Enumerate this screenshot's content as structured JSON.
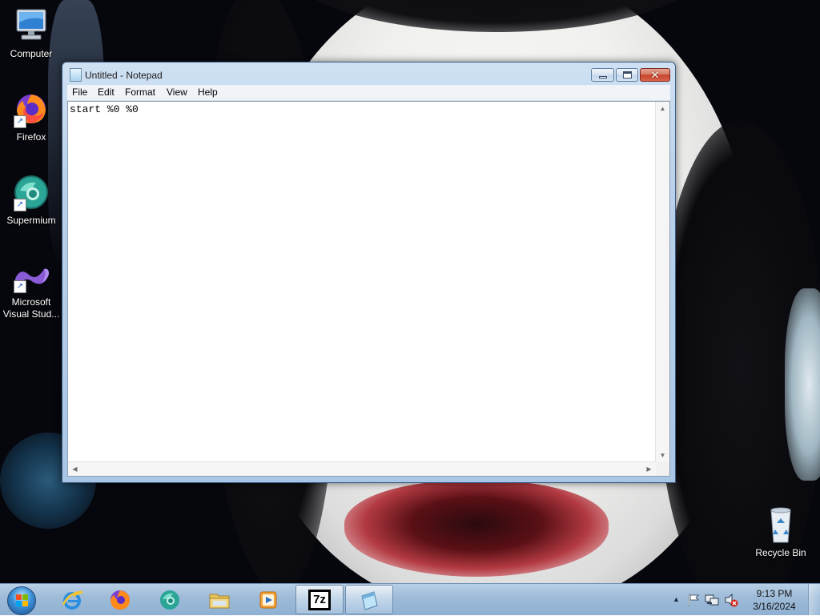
{
  "desktop": {
    "icons": [
      {
        "label": "Computer",
        "icon": "computer-icon"
      },
      {
        "label": "Firefox",
        "icon": "firefox-icon"
      },
      {
        "label": "Supermium",
        "icon": "supermium-icon"
      },
      {
        "label": "Microsoft Visual Stud...",
        "icon": "visual-studio-icon"
      },
      {
        "label": "Recycle Bin",
        "icon": "recycle-bin-icon"
      }
    ]
  },
  "notepad": {
    "title": "Untitled - Notepad",
    "menu": [
      "File",
      "Edit",
      "Format",
      "View",
      "Help"
    ],
    "content": "start %0 %0",
    "caption_buttons": {
      "minimize": "minimize-icon",
      "maximize": "maximize-icon",
      "close": "close-icon"
    },
    "close_symbol": "✕"
  },
  "taskbar": {
    "items": [
      {
        "name": "internet-explorer",
        "icon": "internet-explorer-icon"
      },
      {
        "name": "firefox",
        "icon": "firefox-icon"
      },
      {
        "name": "supermium",
        "icon": "supermium-icon"
      },
      {
        "name": "file-explorer",
        "icon": "folder-icon"
      },
      {
        "name": "media-player",
        "icon": "media-player-icon"
      },
      {
        "name": "7zip",
        "icon": "7zip-icon",
        "label": "7z"
      },
      {
        "name": "notepad",
        "icon": "notepad-icon",
        "active": true
      }
    ],
    "tray": {
      "show_hidden": "▲",
      "time": "9:13 PM",
      "date": "3/16/2024"
    }
  },
  "colors": {
    "accent": "#3a8fd6",
    "close_button": "#c7432c",
    "taskbar": "#9fbcd9"
  }
}
